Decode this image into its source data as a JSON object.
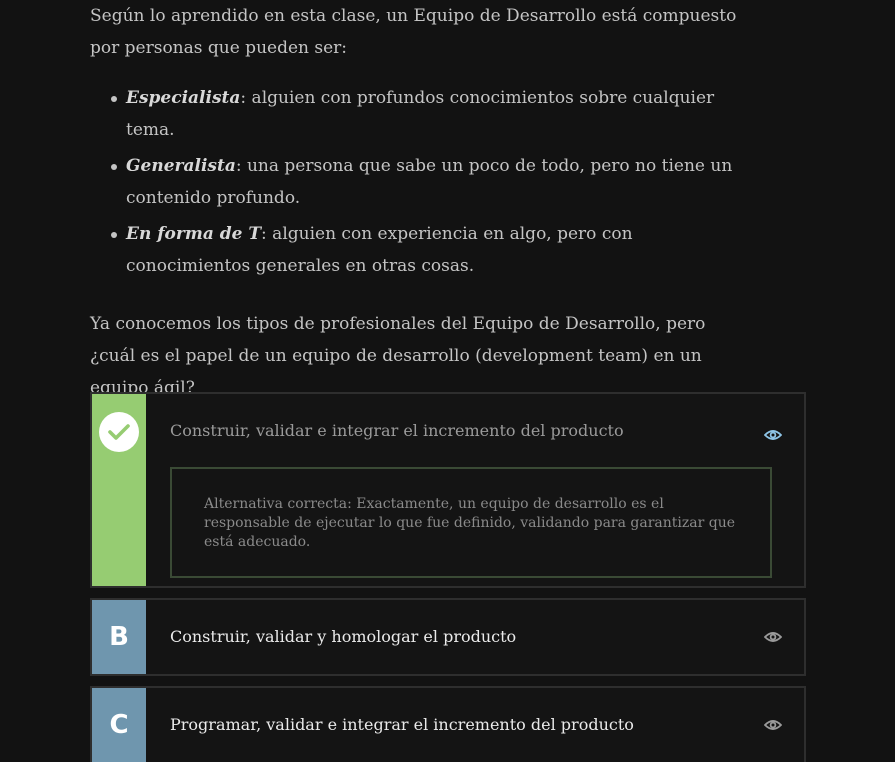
{
  "lesson": {
    "intro": "Según lo aprendido en esta clase, un Equipo de Desarrollo está compuesto por personas que pueden ser:",
    "types": [
      {
        "term": "Especialista",
        "description": ": alguien con profundos conocimientos sobre cualquier tema."
      },
      {
        "term": "Generalista",
        "description": ": una persona que sabe un poco de todo, pero no tiene un contenido profundo."
      },
      {
        "term": "En forma de T",
        "description": ": alguien con experiencia en algo, pero con conocimientos generales en otras cosas."
      }
    ],
    "question": "Ya conocemos los tipos de profesionales del Equipo de Desarrollo, pero ¿cuál es el papel de un equipo de desarrollo (development team) en un equipo ágil?"
  },
  "options": [
    {
      "letter": "",
      "label": "Construir, validar e integrar el incremento del producto",
      "state": "correct",
      "feedback": "Alternativa correcta: Exactamente, un equipo de desarrollo es el responsable de ejecutar lo que fue definido, validando para garantizar que está adecuado."
    },
    {
      "letter": "B",
      "label": "Construir, validar y homologar el producto",
      "state": "unanswered"
    },
    {
      "letter": "C",
      "label": "Programar, validar e integrar el incremento del producto",
      "state": "unanswered"
    }
  ],
  "icons": {
    "correct": "check-icon",
    "reveal": "eye-icon"
  },
  "colors": {
    "correct": "#96cc72",
    "letter_bg": "#6f96ae",
    "eye_active": "#8ec4e6",
    "eye_inactive": "#9a9a9a"
  }
}
